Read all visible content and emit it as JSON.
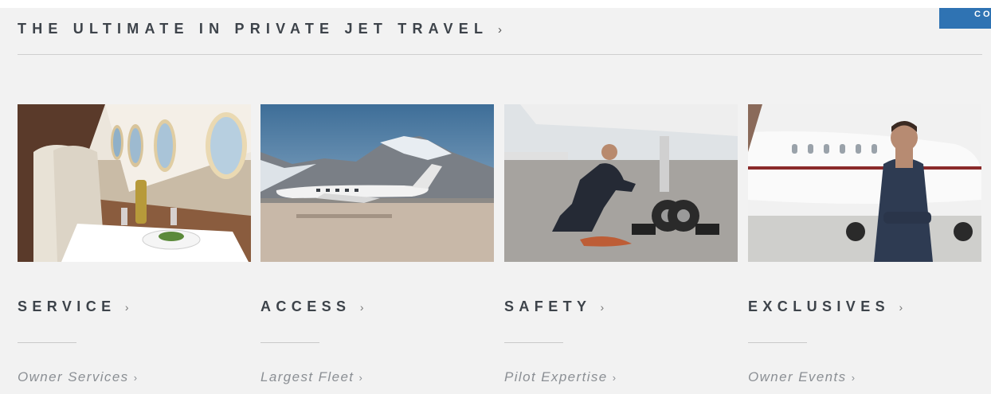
{
  "cta": {
    "label": "CONTACT"
  },
  "header": {
    "title": "THE ULTIMATE IN PRIVATE JET TRAVEL",
    "chevron": "›"
  },
  "cards": [
    {
      "title": "SERVICE",
      "chevron": "›",
      "sublink": "Owner Services",
      "sublink_chevron": "›",
      "image": "cabin-dining-photo"
    },
    {
      "title": "ACCESS",
      "chevron": "›",
      "sublink": "Largest Fleet",
      "sublink_chevron": "›",
      "image": "jet-mountains-photo"
    },
    {
      "title": "SAFETY",
      "chevron": "›",
      "sublink": "Pilot Expertise",
      "sublink_chevron": "›",
      "image": "pilot-inspection-photo"
    },
    {
      "title": "EXCLUSIVES",
      "chevron": "›",
      "sublink": "Owner Events",
      "sublink_chevron": "›",
      "image": "ambassador-jet-photo"
    }
  ],
  "colors": {
    "accent": "#2f73b3",
    "heading": "#3d434a",
    "muted": "#8b8f94",
    "background": "#f2f2f2"
  }
}
